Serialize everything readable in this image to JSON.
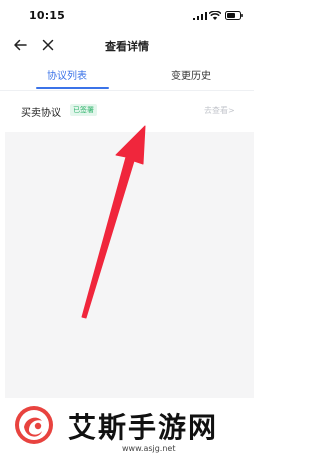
{
  "status_bar": {
    "time": "10:15",
    "icons": [
      "signal-icon",
      "wifi-icon",
      "battery-icon"
    ]
  },
  "nav": {
    "title": "查看详情",
    "back_icon": "back-arrow-icon",
    "close_icon": "close-icon"
  },
  "tabs": [
    {
      "label": "协议列表",
      "active": true
    },
    {
      "label": "变更历史",
      "active": false
    }
  ],
  "agreement": {
    "title": "买卖协议",
    "status": "已签署",
    "action": "去查看>"
  },
  "watermark": {
    "logo_text": "艾斯手游网",
    "url": "www.asjg.net"
  },
  "colors": {
    "accent": "#3b73e8",
    "badge_text": "#2fb36b",
    "badge_bg": "#e3f6ec",
    "arrow": "#f0263c",
    "preview_bg": "#f5f5f6"
  }
}
